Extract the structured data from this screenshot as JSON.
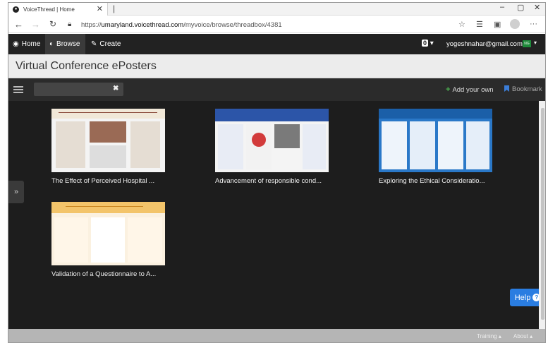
{
  "browser": {
    "tab_title": "VoiceThread | Home",
    "url_prefix": "https://",
    "url_host": "umaryland.voicethread.com",
    "url_path": "/myvoice/browse/threadbox/4381",
    "new_tab": "|",
    "tab_close": "✕"
  },
  "appnav": {
    "home": "Home",
    "browse": "Browse",
    "create": "Create",
    "notification_count": "0",
    "account_email": "yogeshnahar@gmail.com",
    "flag_text": "NG"
  },
  "page": {
    "title": "Virtual Conference ePosters"
  },
  "toolbar": {
    "search_value": "",
    "add_your_own": "Add your own",
    "bookmark": "Bookmark"
  },
  "cards": [
    {
      "caption": "The Effect of Perceived Hospital ...",
      "accent": "#8a4a3a"
    },
    {
      "caption": "Advancement of responsible cond...",
      "accent": "#2c55a8"
    },
    {
      "caption": "Exploring the Ethical Consideratio...",
      "accent": "#2a78c8"
    },
    {
      "caption": "Validation of a Questionnaire to A...",
      "accent": "#c8841e"
    }
  ],
  "help": {
    "label": "Help",
    "q": "?"
  },
  "footer": {
    "training": "Training",
    "about": "About"
  },
  "colors": {
    "nav_bg": "#222222",
    "content_bg": "#1d1d1d",
    "help_blue": "#2a7de1",
    "add_green": "#4cb050"
  }
}
